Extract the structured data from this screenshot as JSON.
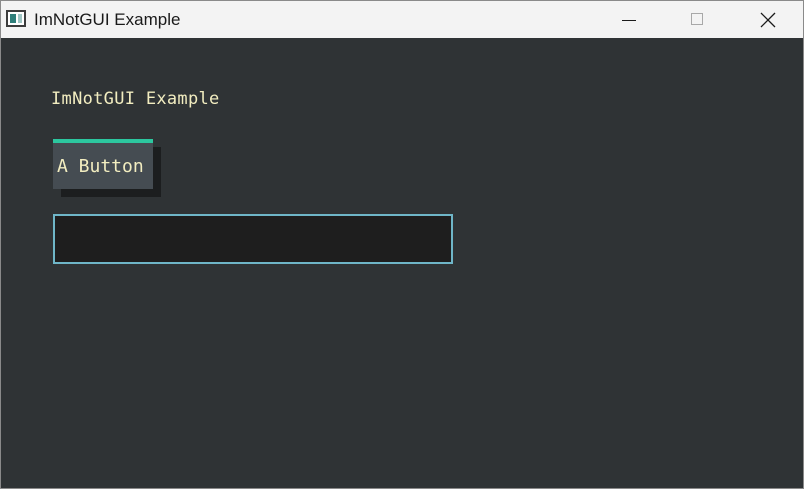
{
  "window": {
    "title": "ImNotGUI Example",
    "controls": {
      "minimize": "minimize",
      "maximize": "maximize",
      "close": "close"
    }
  },
  "main": {
    "heading": "ImNotGUI Example",
    "button_label": "A Button",
    "text_input": {
      "value": "",
      "placeholder": ""
    }
  },
  "colors": {
    "background": "#2f3335",
    "text": "#f2edc0",
    "button_face": "#454c52",
    "button_accent": "#2cc79f",
    "input_border": "#6fb6c8",
    "input_bg": "#1e1e1e"
  },
  "icons": {
    "app": "app-window-icon",
    "minimize": "minimize-icon",
    "maximize": "maximize-icon",
    "close": "close-icon"
  }
}
